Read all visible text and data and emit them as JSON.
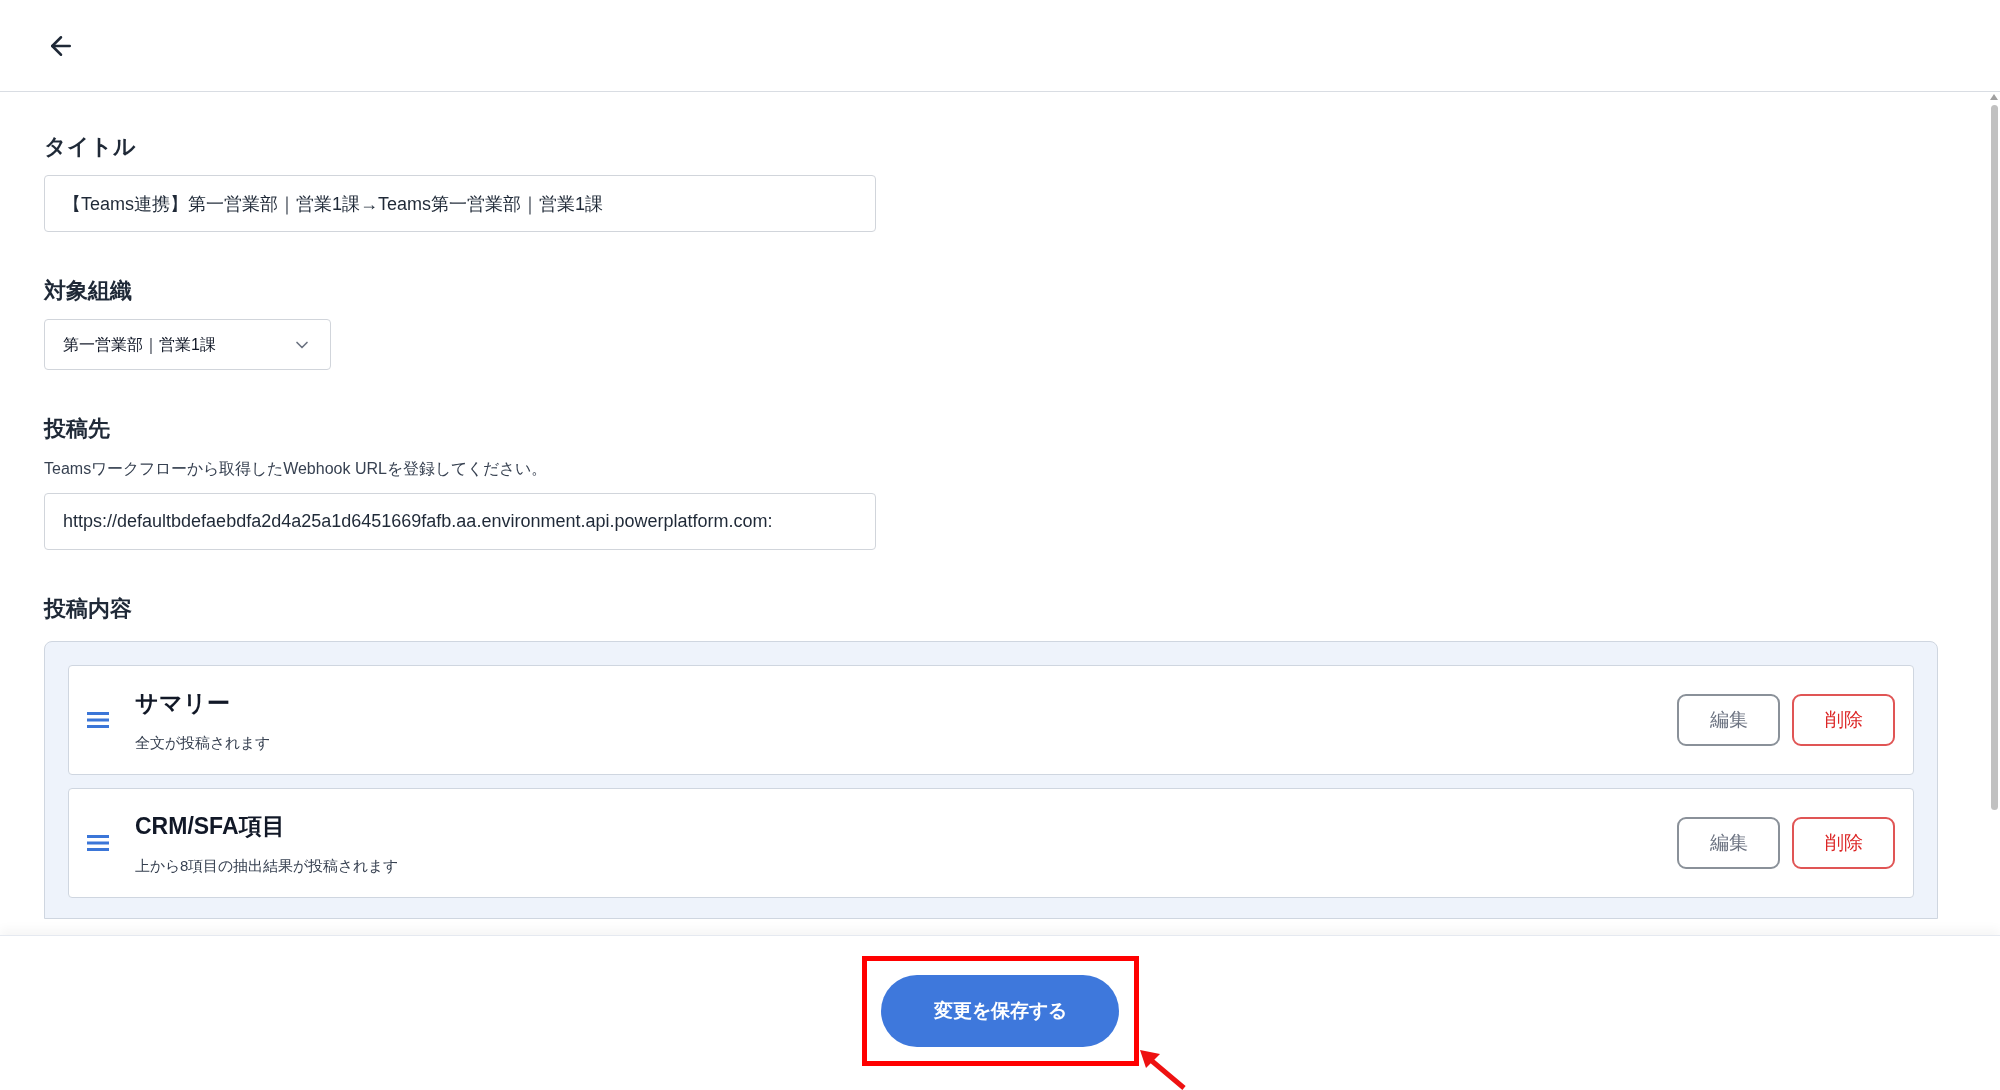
{
  "fields": [
    {
      "kind": "text",
      "label": "タイトル",
      "value": "【Teams連携】第一営業部｜営業1課→Teams第一営業部｜営業1課"
    },
    {
      "kind": "select",
      "label": "対象組織",
      "value": "第一営業部｜営業1課"
    },
    {
      "kind": "text",
      "label": "投稿先",
      "help": "Teamsワークフローから取得したWebhook URLを登録してください。",
      "value": "https://defaultbdefaebdfa2d4a25a1d6451669fafb.aa.environment.api.powerplatform.com:"
    }
  ],
  "content": {
    "label": "投稿内容",
    "items": [
      {
        "title": "サマリー",
        "description": "全文が投稿されます",
        "buttons": [
          {
            "kind": "edit",
            "label": "編集"
          },
          {
            "kind": "delete",
            "label": "削除"
          }
        ]
      },
      {
        "title": "CRM/SFA項目",
        "description": "上から8項目の抽出結果が投稿されます",
        "buttons": [
          {
            "kind": "edit",
            "label": "編集"
          },
          {
            "kind": "delete",
            "label": "削除"
          }
        ]
      }
    ]
  },
  "save_button": "変更を保存する"
}
